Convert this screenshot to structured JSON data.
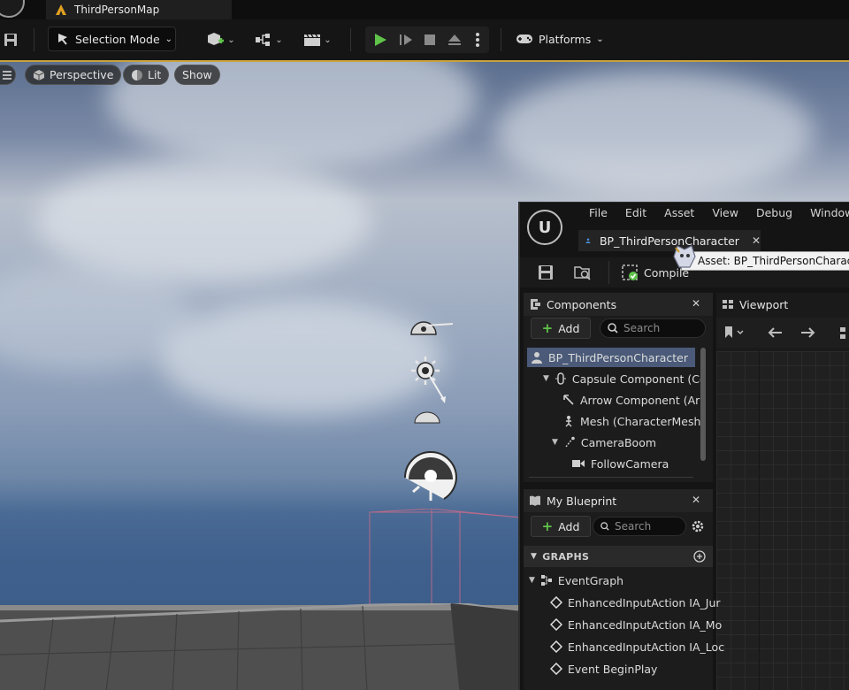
{
  "editor": {
    "level_tab": "ThirdPersonMap",
    "toolbar": {
      "selection_mode": "Selection Mode",
      "platforms": "Platforms"
    },
    "viewport": {
      "perspective": "Perspective",
      "lit": "Lit",
      "show": "Show"
    }
  },
  "blueprint": {
    "menu": [
      "File",
      "Edit",
      "Asset",
      "View",
      "Debug",
      "Window"
    ],
    "tab_title": "BP_ThirdPersonCharacter",
    "toolbar": {
      "compile": "Compile"
    },
    "tooltip": "Asset: BP_ThirdPersonCharacter",
    "components": {
      "title": "Components",
      "add": "Add",
      "search_placeholder": "Search",
      "tree": [
        {
          "label": "BP_ThirdPersonCharacter",
          "icon": "character-icon"
        },
        {
          "label": "Capsule Component (Co",
          "icon": "capsule-icon"
        },
        {
          "label": "Arrow Component (Arr",
          "icon": "arrow-icon"
        },
        {
          "label": "Mesh (CharacterMesh",
          "icon": "skeletal-mesh-icon"
        },
        {
          "label": "CameraBoom",
          "icon": "spring-arm-icon"
        },
        {
          "label": "FollowCamera",
          "icon": "camera-icon"
        }
      ]
    },
    "viewport_tab": {
      "title": "Viewport"
    },
    "my_blueprint": {
      "title": "My Blueprint",
      "add": "Add",
      "search_placeholder": "Search",
      "graphs_header": "GRAPHS",
      "event_graph": "EventGraph",
      "events": [
        "EnhancedInputAction IA_Jur",
        "EnhancedInputAction IA_Mo",
        "EnhancedInputAction IA_Loc",
        "Event BeginPlay"
      ]
    }
  },
  "colors": {
    "accent": "#c9a23a",
    "play_green": "#5fc34a",
    "selection": "#4a5a78"
  }
}
